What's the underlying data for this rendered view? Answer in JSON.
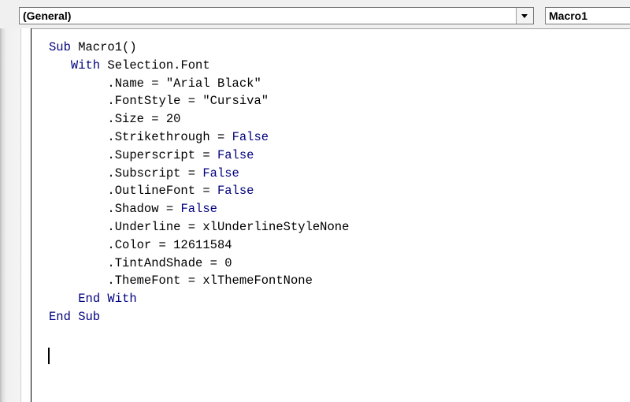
{
  "object_dropdown": {
    "value": "(General)"
  },
  "procedure_dropdown": {
    "value": "Macro1"
  },
  "colors": {
    "keyword": "#00007f",
    "text": "#000000"
  },
  "code_lines": [
    {
      "indent": "",
      "segments": [
        {
          "text": "Sub",
          "kind": "keyword"
        },
        {
          "text": " Macro1()",
          "kind": "text"
        }
      ]
    },
    {
      "indent": "   ",
      "segments": [
        {
          "text": "With",
          "kind": "keyword"
        },
        {
          "text": " Selection.Font",
          "kind": "text"
        }
      ]
    },
    {
      "indent": "        ",
      "segments": [
        {
          "text": ".Name = \"Arial Black\"",
          "kind": "text"
        }
      ]
    },
    {
      "indent": "        ",
      "segments": [
        {
          "text": ".FontStyle = \"Cursiva\"",
          "kind": "text"
        }
      ]
    },
    {
      "indent": "        ",
      "segments": [
        {
          "text": ".Size = 20",
          "kind": "text"
        }
      ]
    },
    {
      "indent": "        ",
      "segments": [
        {
          "text": ".Strikethrough = ",
          "kind": "text"
        },
        {
          "text": "False",
          "kind": "keyword"
        }
      ]
    },
    {
      "indent": "        ",
      "segments": [
        {
          "text": ".Superscript = ",
          "kind": "text"
        },
        {
          "text": "False",
          "kind": "keyword"
        }
      ]
    },
    {
      "indent": "        ",
      "segments": [
        {
          "text": ".Subscript = ",
          "kind": "text"
        },
        {
          "text": "False",
          "kind": "keyword"
        }
      ]
    },
    {
      "indent": "        ",
      "segments": [
        {
          "text": ".OutlineFont = ",
          "kind": "text"
        },
        {
          "text": "False",
          "kind": "keyword"
        }
      ]
    },
    {
      "indent": "        ",
      "segments": [
        {
          "text": ".Shadow = ",
          "kind": "text"
        },
        {
          "text": "False",
          "kind": "keyword"
        }
      ]
    },
    {
      "indent": "        ",
      "segments": [
        {
          "text": ".Underline = xlUnderlineStyleNone",
          "kind": "text"
        }
      ]
    },
    {
      "indent": "        ",
      "segments": [
        {
          "text": ".Color = 12611584",
          "kind": "text"
        }
      ]
    },
    {
      "indent": "        ",
      "segments": [
        {
          "text": ".TintAndShade = 0",
          "kind": "text"
        }
      ]
    },
    {
      "indent": "        ",
      "segments": [
        {
          "text": ".ThemeFont = xlThemeFontNone",
          "kind": "text"
        }
      ]
    },
    {
      "indent": "    ",
      "segments": [
        {
          "text": "End With",
          "kind": "keyword"
        }
      ]
    },
    {
      "indent": "",
      "segments": [
        {
          "text": "End Sub",
          "kind": "keyword"
        }
      ]
    }
  ]
}
